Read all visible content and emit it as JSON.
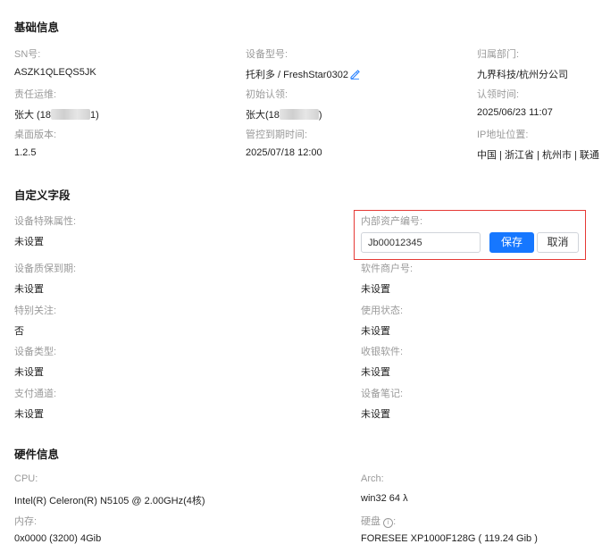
{
  "basic": {
    "title": "基础信息",
    "sn_label": "SN号:",
    "sn_value": "ASZK1QLEQS5JK",
    "model_label": "设备型号:",
    "model_value": "托利多  / FreshStar0302",
    "dept_label": "归属部门:",
    "dept_value": "九界科技/杭州分公司",
    "ops_label": "责任运维:",
    "ops_name": "张大 (18",
    "ops_suffix": "1)",
    "initial_claim_label": "初始认领:",
    "initial_claim_name": "张大(18",
    "initial_claim_suffix": ")",
    "claim_time_label": "认领时间:",
    "claim_time_value": "2025/06/23 11:07",
    "desktop_version_label": "桌面版本:",
    "desktop_version_value": "1.2.5",
    "managed_expiry_label": "管控到期时间:",
    "managed_expiry_value": "2025/07/18 12:00",
    "ip_location_label": "IP地址位置:",
    "ip_location_value": "中国 | 浙江省 | 杭州市 | 联通"
  },
  "custom": {
    "title": "自定义字段",
    "special_attr_label": "设备特殊属性:",
    "special_attr_value": "未设置",
    "asset_no_label": "内部资产编号:",
    "asset_no_input": "Jb00012345",
    "save_label": "保存",
    "cancel_label": "取消",
    "warranty_label": "设备质保到期:",
    "warranty_value": "未设置",
    "software_merchant_label": "软件商户号:",
    "software_merchant_value": "未设置",
    "special_attention_label": "特别关注:",
    "special_attention_value": "否",
    "usage_status_label": "使用状态:",
    "usage_status_value": "未设置",
    "device_type_label": "设备类型:",
    "device_type_value": "未设置",
    "cashier_software_label": "收银软件:",
    "cashier_software_value": "未设置",
    "payment_channel_label": "支付通道:",
    "payment_channel_value": "未设置",
    "device_notes_label": "设备笔记:",
    "device_notes_value": "未设置"
  },
  "hardware": {
    "title": "硬件信息",
    "cpu_label": "CPU:",
    "cpu_value": "Intel(R) Celeron(R) N5105 @ 2.00GHz(4核)",
    "arch_label": "Arch:",
    "arch_value": "win32 64 λ",
    "memory_label": "内存:",
    "memory_value": "0x0000 (3200) 4Gib",
    "disk_label": "硬盘",
    "disk_label_colon": ":",
    "disk_value": "FORESEE XP1000F128G ( 119.24 Gib )"
  },
  "colors": {
    "accent": "#1677ff",
    "highlight_border": "#e53935",
    "label_text": "#9a9a9a"
  },
  "icons": {
    "edit": "edit-pencil-icon",
    "info": "info-circle-icon"
  }
}
